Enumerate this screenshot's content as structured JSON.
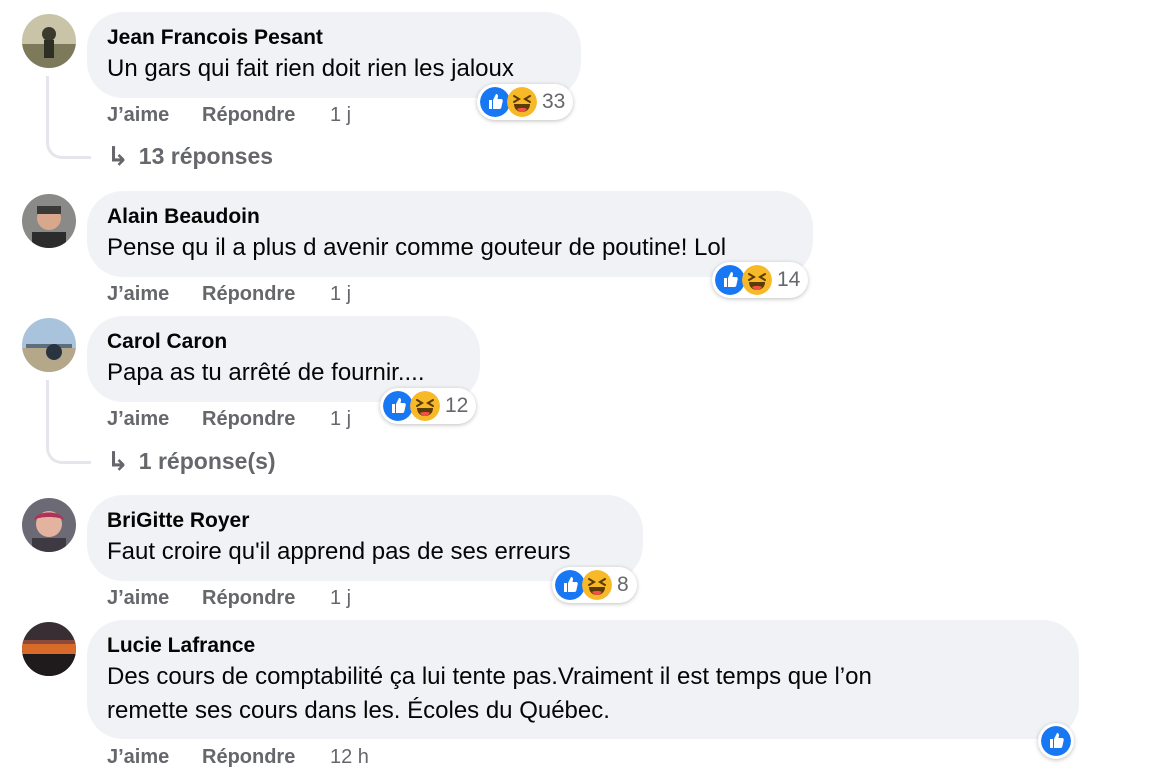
{
  "actions": {
    "like_label": "J’aime",
    "reply_label": "Répondre"
  },
  "colors": {
    "like_blue": "#1877f2",
    "haha_yellow": "#f7b928",
    "bubble_bg": "#f0f2f5",
    "meta_gray": "#65676b"
  },
  "icons": {
    "like": "thumbs-up-icon",
    "haha": "laughing-emoji-icon",
    "reply_arrow": "reply-arrow-icon"
  },
  "comments": [
    {
      "author": "Jean Francois Pesant",
      "text": "Un gars qui fait rien doit rien les jaloux",
      "time": "1 j",
      "reaction_count": "33",
      "replies": "13 réponses"
    },
    {
      "author": "Alain Beaudoin",
      "text": "Pense qu il a plus d avenir comme gouteur de poutine! Lol",
      "time": "1 j",
      "reaction_count": "14"
    },
    {
      "author": "Carol Caron",
      "text": "Papa as tu arrêté de fournir....",
      "time": "1 j",
      "reaction_count": "12",
      "replies": "1 réponse(s)"
    },
    {
      "author": "BriGitte Royer",
      "text": "Faut croire qu'il apprend pas de ses erreurs",
      "time": "1 j",
      "reaction_count": "8"
    },
    {
      "author": "Lucie Lafrance",
      "text_line1": "Des cours de comptabilité ça lui tente pas.Vraiment il est temps que l’on",
      "text_line2": "remette ses cours dans les. Écoles du Québec.",
      "time": "12 h"
    }
  ]
}
